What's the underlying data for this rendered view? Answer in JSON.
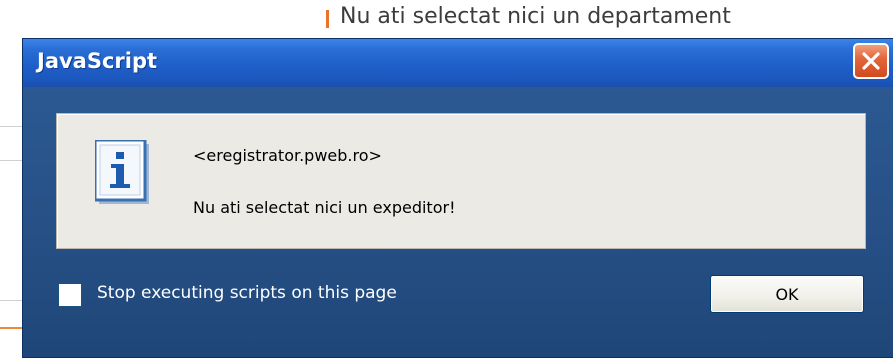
{
  "background_page": {
    "heading_fragment": "Nu ati selectat nici un departament"
  },
  "dialog": {
    "title": "JavaScript",
    "message_host": "<eregistrator.pweb.ro>",
    "message_body": "Nu ati selectat nici un expeditor!",
    "checkbox": {
      "label": "Stop executing scripts on this page",
      "checked": false
    },
    "ok_label": "OK"
  },
  "colors": {
    "titlebar_blue": "#1f5fc9",
    "dialog_body_blue": "#265086",
    "close_red": "#d24a20",
    "panel_gray": "#ebeae4"
  },
  "icons": {
    "message_icon": "info-icon",
    "close_icon": "close-icon"
  }
}
